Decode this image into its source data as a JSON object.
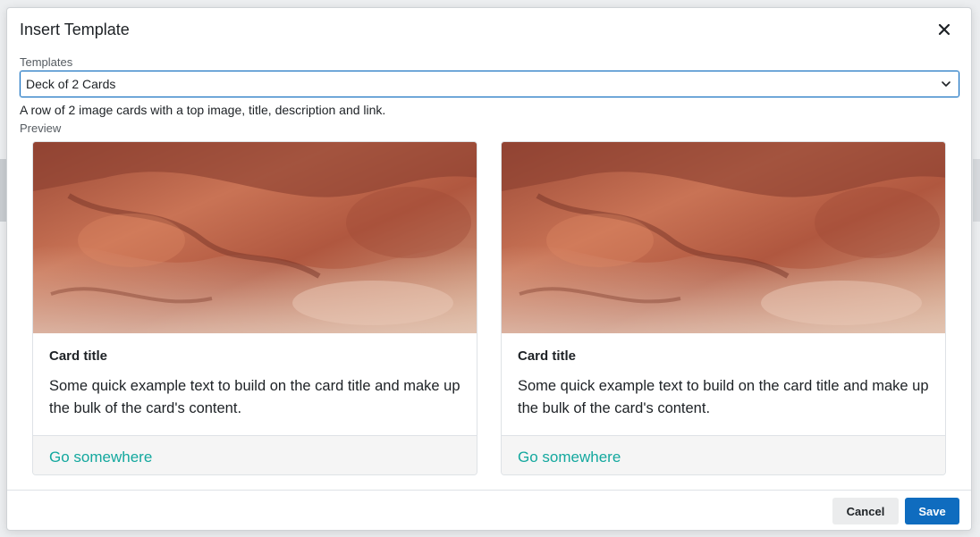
{
  "modal": {
    "title": "Insert Template",
    "close_icon": "close-icon"
  },
  "templates": {
    "label": "Templates",
    "selected": "Deck of 2 Cards",
    "chevron_icon": "chevron-down-icon",
    "description": "A row of 2 image cards with a top image, title, description and link."
  },
  "preview": {
    "label": "Preview",
    "cards": [
      {
        "title": "Card title",
        "text": "Some quick example text to build on the card title and make up the bulk of the card's content.",
        "link": "Go somewhere"
      },
      {
        "title": "Card title",
        "text": "Some quick example text to build on the card title and make up the bulk of the card's content.",
        "link": "Go somewhere"
      }
    ]
  },
  "footer": {
    "cancel_label": "Cancel",
    "save_label": "Save"
  },
  "colors": {
    "primary": "#0f6cbf",
    "link": "#13a89e",
    "footer_bg": "#f5f5f5"
  }
}
